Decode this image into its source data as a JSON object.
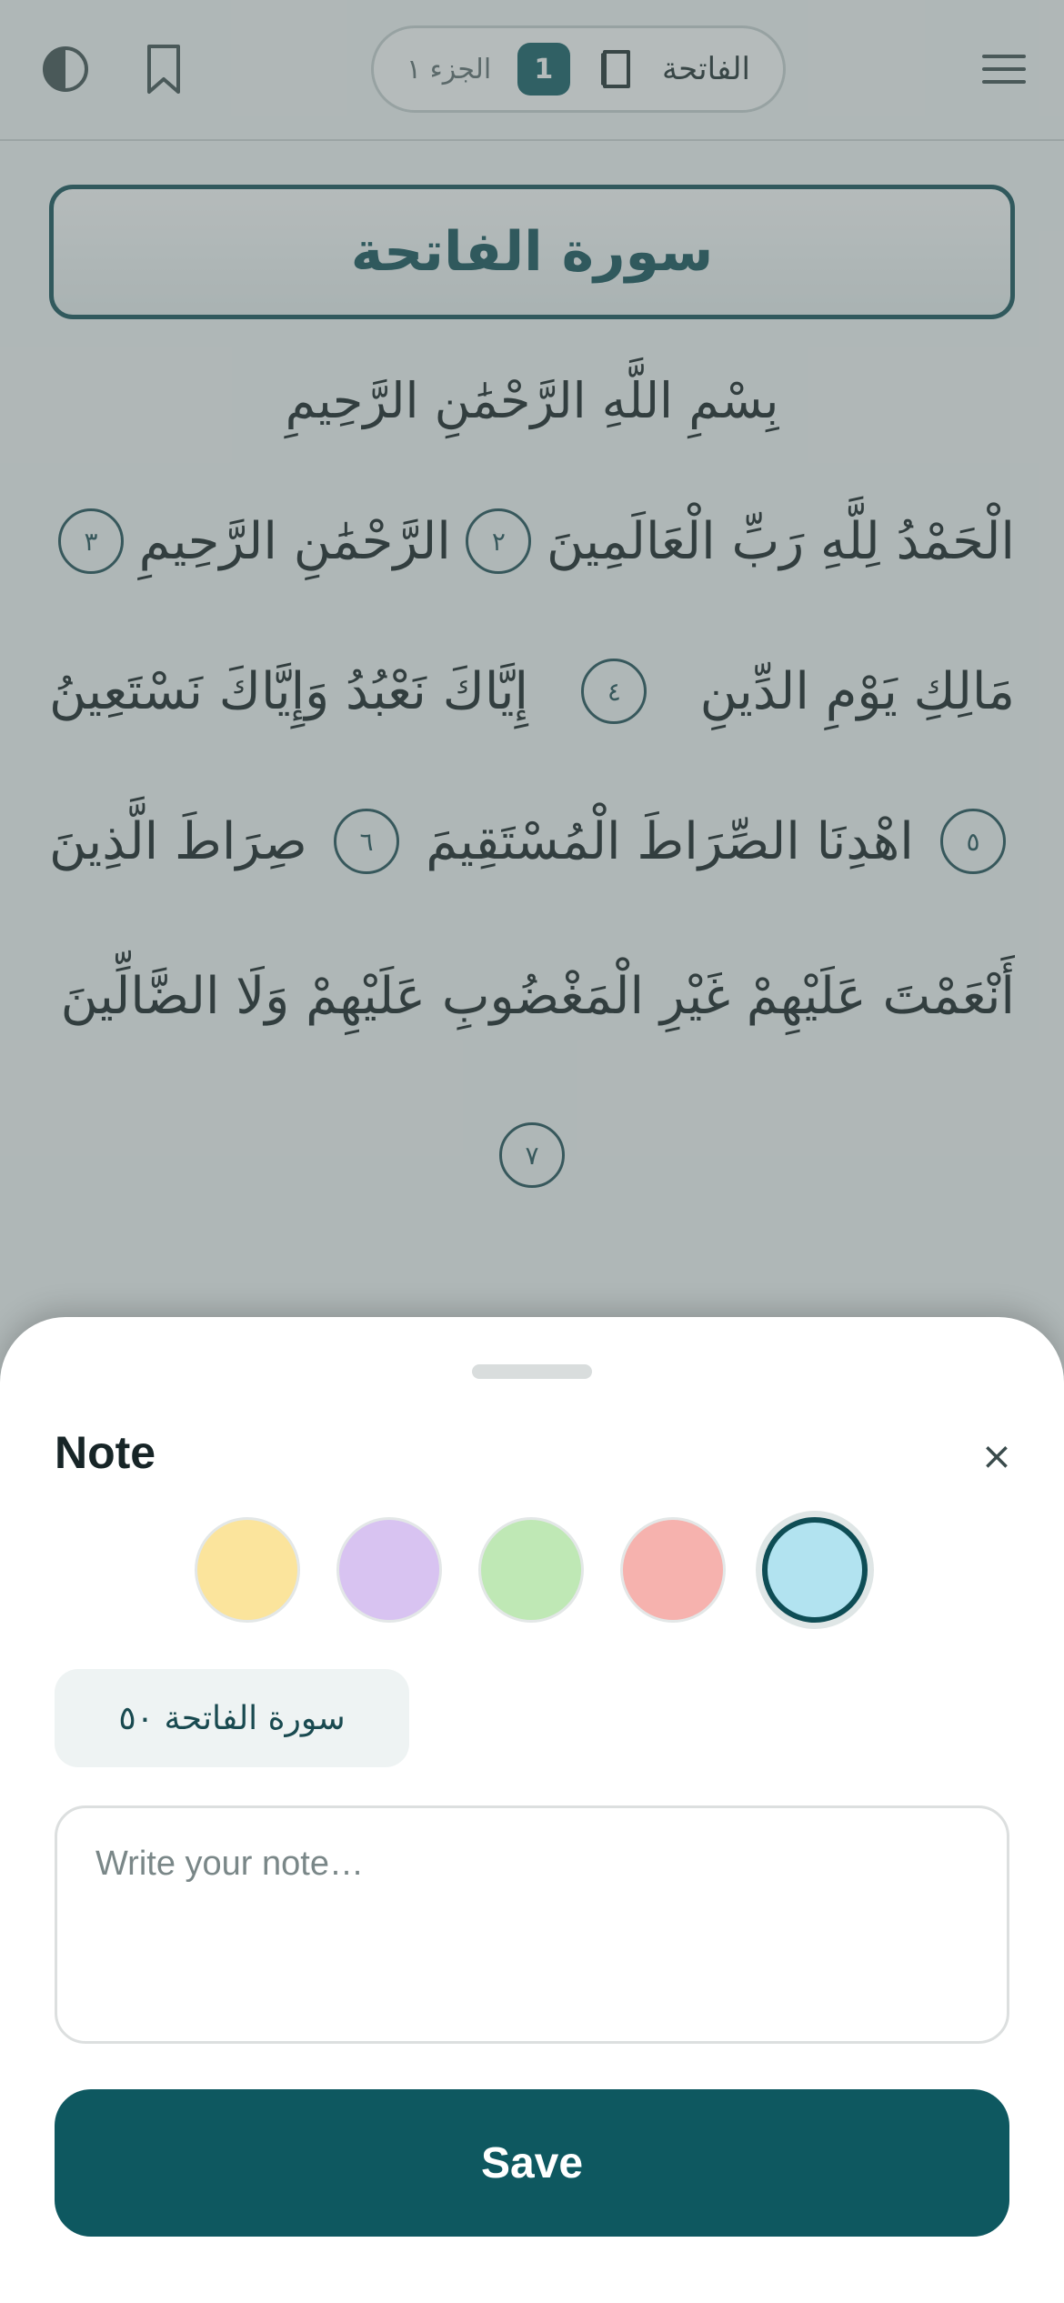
{
  "header": {
    "juz_label": "الجزء ١",
    "page_number": "1",
    "surah_name": "الفاتحة",
    "icons": {
      "contrast": "contrast-icon",
      "bookmark": "bookmark-icon",
      "book": "book-icon",
      "menu": "menu-icon"
    }
  },
  "mushaf": {
    "surah_title": "سورة الفاتحة",
    "basmala": "بِسْمِ اللَّهِ الرَّحْمَٰنِ الرَّحِيمِ",
    "lines": [
      {
        "parts": [
          {
            "text": "الْحَمْدُ لِلَّهِ رَبِّ الْعَالَمِينَ"
          },
          {
            "marker": "٢"
          },
          {
            "text": "الرَّحْمَٰنِ الرَّحِيمِ"
          },
          {
            "marker": "٣"
          }
        ]
      },
      {
        "parts": [
          {
            "text": "مَالِكِ يَوْمِ الدِّينِ"
          },
          {
            "marker": "٤"
          },
          {
            "text": "إِيَّاكَ نَعْبُدُ وَإِيَّاكَ نَسْتَعِينُ"
          }
        ]
      },
      {
        "parts": [
          {
            "marker": "٥"
          },
          {
            "text": "اهْدِنَا الصِّرَاطَ الْمُسْتَقِيمَ"
          },
          {
            "marker": "٦"
          },
          {
            "text": "صِرَاطَ الَّذِينَ"
          }
        ]
      },
      {
        "parts": [
          {
            "text": "أَنْعَمْتَ عَلَيْهِمْ غَيْرِ الْمَغْضُوبِ عَلَيْهِمْ وَلَا الضَّالِّينَ"
          }
        ]
      },
      {
        "parts": [
          {
            "marker": "٧"
          }
        ]
      }
    ]
  },
  "note_sheet": {
    "title": "Note",
    "close_icon": "close-icon",
    "colors": [
      {
        "name": "yellow",
        "hex": "#fbe49c"
      },
      {
        "name": "purple",
        "hex": "#d8c3f1"
      },
      {
        "name": "green",
        "hex": "#bfe8b5"
      },
      {
        "name": "pink",
        "hex": "#f6b2ae"
      },
      {
        "name": "blue",
        "hex": "#b2e3f0"
      }
    ],
    "selected_color": "blue",
    "verse_reference": "سورة الفاتحة ٥٠",
    "note_value": "",
    "note_placeholder": "Write your note…",
    "save_label": "Save"
  }
}
